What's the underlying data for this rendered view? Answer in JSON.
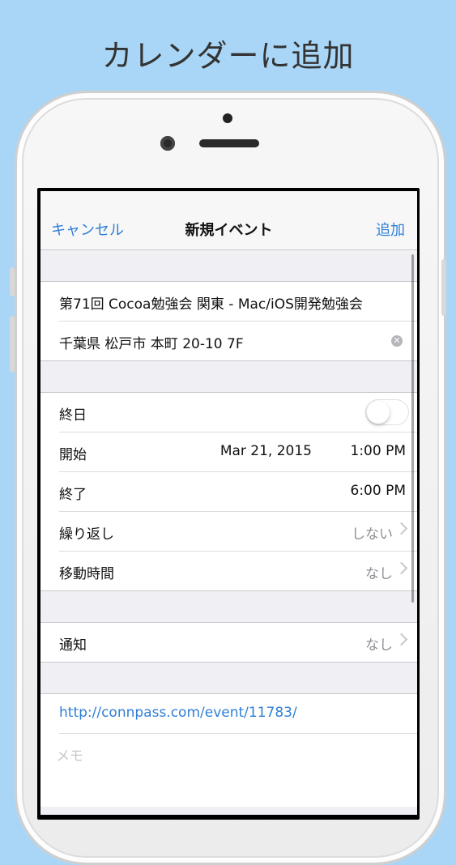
{
  "promo": {
    "title": "カレンダーに追加"
  },
  "nav": {
    "cancel": "キャンセル",
    "title": "新規イベント",
    "add": "追加"
  },
  "event": {
    "title": "第71回 Cocoa勉強会 関東 - Mac/iOS開発勉強会",
    "location": "千葉県 松戸市 本町 20-10 7F"
  },
  "schedule": {
    "allday_label": "終日",
    "allday_on": false,
    "start_label": "開始",
    "start_date": "Mar 21, 2015",
    "start_time": "1:00 PM",
    "end_label": "終了",
    "end_time": "6:00 PM",
    "repeat_label": "繰り返し",
    "repeat_value": "しない",
    "travel_label": "移動時間",
    "travel_value": "なし"
  },
  "alert": {
    "label": "通知",
    "value": "なし"
  },
  "notes": {
    "url": "http://connpass.com/event/11783/",
    "memo_placeholder": "メモ"
  },
  "colors": {
    "background": "#a9d6f7",
    "accent": "#2f7fd6"
  }
}
